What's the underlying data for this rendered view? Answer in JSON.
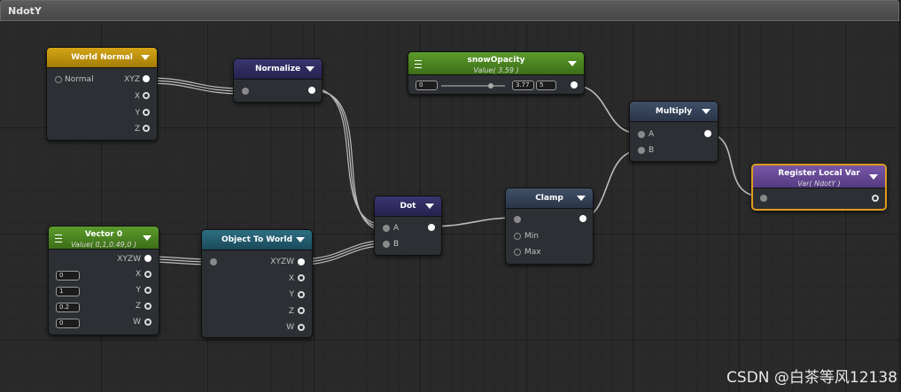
{
  "window": {
    "title": "NdotY"
  },
  "nodes": {
    "world_normal": {
      "title": "World Normal",
      "input": "Normal",
      "outputs": [
        "XYZ",
        "X",
        "Y",
        "Z"
      ]
    },
    "normalize": {
      "title": "Normalize"
    },
    "snow_opacity": {
      "title": "snowOpacity",
      "subtitle": "Value( 3.59 )",
      "min": "0",
      "value": "3.77",
      "max": "5"
    },
    "multiply": {
      "title": "Multiply",
      "inputs": [
        "A",
        "B"
      ]
    },
    "register_local_var": {
      "title": "Register Local Var",
      "subtitle": "Var( NdotY )"
    },
    "dot": {
      "title": "Dot",
      "inputs": [
        "A",
        "B"
      ]
    },
    "clamp": {
      "title": "Clamp",
      "inputs": [
        "Min",
        "Max"
      ]
    },
    "vector0": {
      "title": "Vector 0",
      "subtitle": "Value( 0,1,0.49,0 )",
      "output": "XYZW",
      "components": [
        "X",
        "Y",
        "Z",
        "W"
      ],
      "values": [
        "0",
        "1",
        "0.2",
        "0"
      ]
    },
    "object_to_world": {
      "title": "Object To World",
      "outputs": [
        "XYZW",
        "X",
        "Y",
        "Z",
        "W"
      ]
    }
  },
  "watermark": "CSDN @白茶等风12138",
  "colors": {
    "selection": "#e09b1e",
    "wire": "#c8c8c8"
  }
}
